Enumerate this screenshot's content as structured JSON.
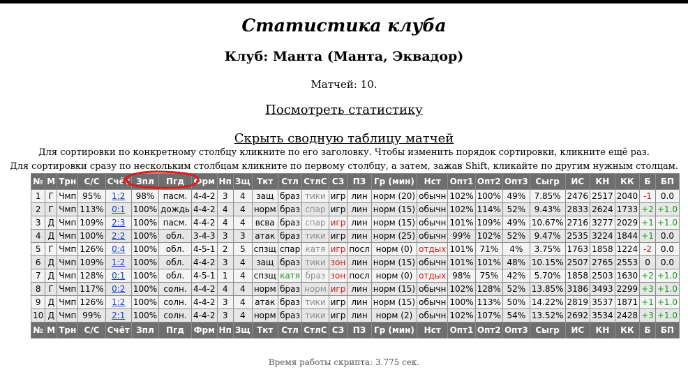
{
  "title": "Статистика клуба",
  "club": "Клуб: Манта (Манта, Эквадор)",
  "matches": "Матчей: 10.",
  "view_stats": "Посмотреть статистику",
  "hide_table": "Скрыть сводную таблицу матчей",
  "hint1": "Для сортировки по конкретному столбцу кликните по его заголовку. Чтобы изменить порядок сортировки, кликните ещё раз.",
  "hint2": "Для сортировки сразу по нескольким столбцам кликните по первому столбцу, а затем, зажав Shift, кликайте по другим нужным столцам.",
  "headers": [
    "№",
    "М",
    "Трн",
    "С/С",
    "Счёт",
    "Зпл",
    "Пгд",
    "Фрм",
    "Нп",
    "Зщ",
    "Ткт",
    "Стл",
    "СтлС",
    "СЗ",
    "ПЗ",
    "Гр (мин)",
    "Нст",
    "Опт1",
    "Опт2",
    "Опт3",
    "Сыгр",
    "ИС",
    "КН",
    "КК",
    "Б",
    "БП"
  ],
  "rows": [
    [
      "1",
      "Г",
      "Чмп",
      "95%",
      "1:2",
      "98%",
      "пасм.",
      "4-4-2",
      "3",
      "4",
      "защ",
      "браз",
      "тики",
      "игр",
      "лин",
      "норм (20)",
      "обычн",
      "102%",
      "100%",
      "49%",
      "7.85%",
      "2476",
      "2517",
      "2040",
      "-1",
      "0.0"
    ],
    [
      "2",
      "Г",
      "Чмп",
      "113%",
      "0:1",
      "100%",
      "дождь",
      "4-4-2",
      "4",
      "4",
      "норм",
      "браз",
      "спар",
      "игр",
      "лин",
      "норм (15)",
      "обычн",
      "102%",
      "114%",
      "52%",
      "9.43%",
      "2833",
      "2624",
      "1733",
      "+2",
      "+1.0"
    ],
    [
      "3",
      "Д",
      "Чмп",
      "109%",
      "2:3",
      "100%",
      "пасм.",
      "4-4-2",
      "4",
      "4",
      "всва",
      "браз",
      "спар",
      "игр",
      "лин",
      "норм (15)",
      "обычн",
      "101%",
      "109%",
      "49%",
      "10.67%",
      "2716",
      "3277",
      "2029",
      "+1",
      "+1.0"
    ],
    [
      "4",
      "Д",
      "Чмп",
      "100%",
      "2:2",
      "100%",
      "обл.",
      "3-4-3",
      "3",
      "3",
      "атак",
      "браз",
      "тики",
      "игр",
      "лин",
      "норм (25)",
      "обычн",
      "99%",
      "102%",
      "52%",
      "9.47%",
      "2535",
      "3224",
      "1844",
      "+1",
      "0.0"
    ],
    [
      "5",
      "Г",
      "Чмп",
      "126%",
      "0:4",
      "100%",
      "обл.",
      "4-5-1",
      "2",
      "5",
      "спзщ",
      "спар",
      "катя",
      "игр",
      "посл",
      "норм (0)",
      "отдых",
      "101%",
      "71%",
      "4%",
      "3.75%",
      "1763",
      "1858",
      "1224",
      "-2",
      "0.0"
    ],
    [
      "6",
      "Д",
      "Чмп",
      "109%",
      "1:2",
      "100%",
      "обл.",
      "4-4-2",
      "3",
      "4",
      "защ",
      "браз",
      "тики",
      "зон",
      "лин",
      "норм (15)",
      "обычн",
      "101%",
      "101%",
      "48%",
      "10.15%",
      "2507",
      "2765",
      "2553",
      "0",
      "0.0"
    ],
    [
      "7",
      "Д",
      "Чмп",
      "128%",
      "0:1",
      "100%",
      "обл.",
      "4-5-1",
      "1",
      "4",
      "спзщ",
      "катя",
      "браз",
      "зон",
      "посл",
      "норм (0)",
      "отдых",
      "98%",
      "75%",
      "42%",
      "5.70%",
      "1858",
      "2503",
      "1630",
      "+2",
      "+1.0"
    ],
    [
      "8",
      "Г",
      "Чмп",
      "117%",
      "0:2",
      "100%",
      "солн.",
      "4-4-2",
      "4",
      "4",
      "норм",
      "браз",
      "норм",
      "игр",
      "лин",
      "норм (15)",
      "обычн",
      "102%",
      "128%",
      "52%",
      "13.85%",
      "3186",
      "3493",
      "2299",
      "+3",
      "+1.0"
    ],
    [
      "9",
      "Д",
      "Чмп",
      "126%",
      "1:2",
      "100%",
      "солн.",
      "4-4-2",
      "3",
      "4",
      "атак",
      "браз",
      "тики",
      "игр",
      "лин",
      "норм (15)",
      "обычн",
      "100%",
      "113%",
      "50%",
      "14.22%",
      "2819",
      "3537",
      "1871",
      "+1",
      "+1.0"
    ],
    [
      "10",
      "Д",
      "Чмп",
      "99%",
      "2:1",
      "100%",
      "солн.",
      "4-4-2",
      "3",
      "4",
      "норм",
      "браз",
      "тики",
      "игр",
      "лин",
      "норм (2)",
      "обычн",
      "102%",
      "107%",
      "54%",
      "13.52%",
      "2692",
      "3534",
      "2428",
      "+3",
      "+1.0"
    ]
  ],
  "cell_colors": {
    "gray": "#8d8d8d",
    "red": "#d11a1a",
    "green": "#1a9a1a",
    "header_bg": "#6e6e6e"
  },
  "footer": "Время работы скрипта: 3.775 сек.",
  "annotation_color": "#d81e1e"
}
